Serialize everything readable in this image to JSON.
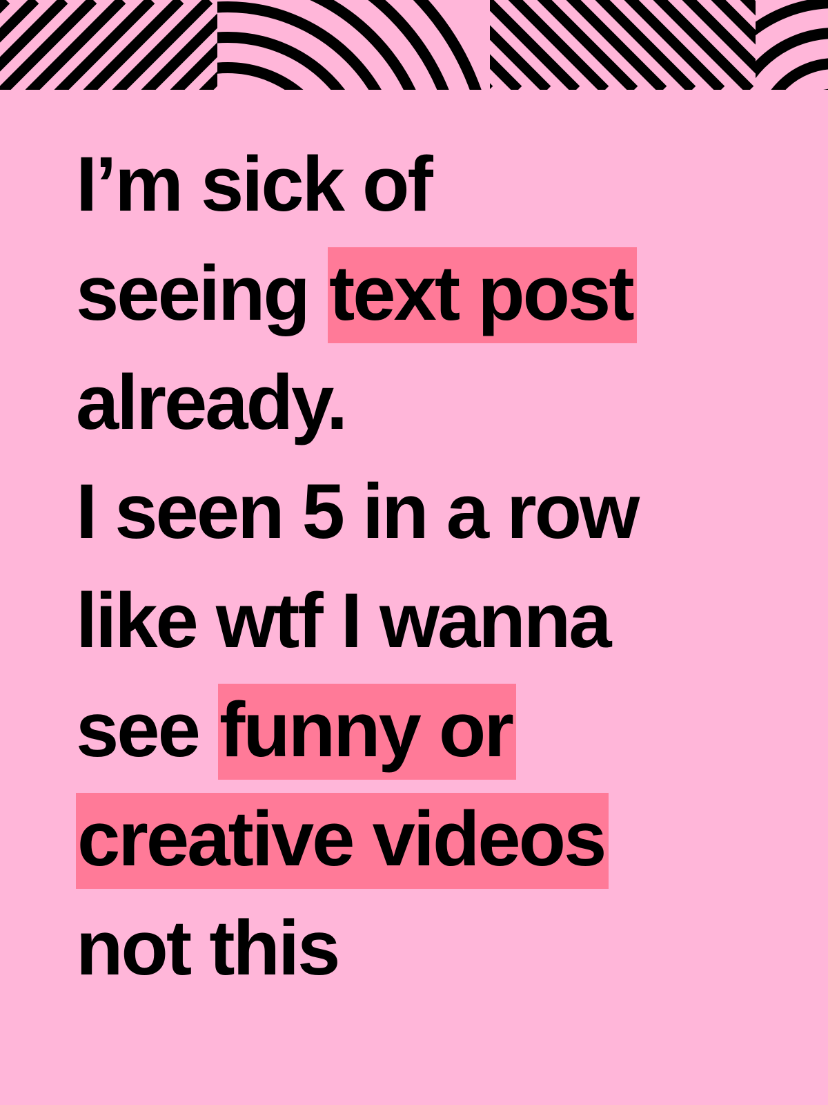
{
  "colors": {
    "background": "#ffb6d9",
    "highlight": "#ff7a98",
    "text": "#000000",
    "pattern": "#000000"
  },
  "banner": {
    "icon": "striped-geometric-pattern"
  },
  "post": {
    "lines": [
      [
        {
          "text": "I’m sick of",
          "highlight": false
        }
      ],
      [
        {
          "text": "seeing ",
          "highlight": false
        },
        {
          "text": "text post",
          "highlight": true
        }
      ],
      [
        {
          "text": "already.",
          "highlight": false
        }
      ],
      [
        {
          "text": "I seen 5 in a row",
          "highlight": false
        }
      ],
      [
        {
          "text": "like wtf I wanna",
          "highlight": false
        }
      ],
      [
        {
          "text": "see ",
          "highlight": false
        },
        {
          "text": "funny or ",
          "highlight": true
        }
      ],
      [
        {
          "text": "creative videos",
          "highlight": true
        }
      ],
      [
        {
          "text": "not this",
          "highlight": false
        }
      ]
    ]
  }
}
